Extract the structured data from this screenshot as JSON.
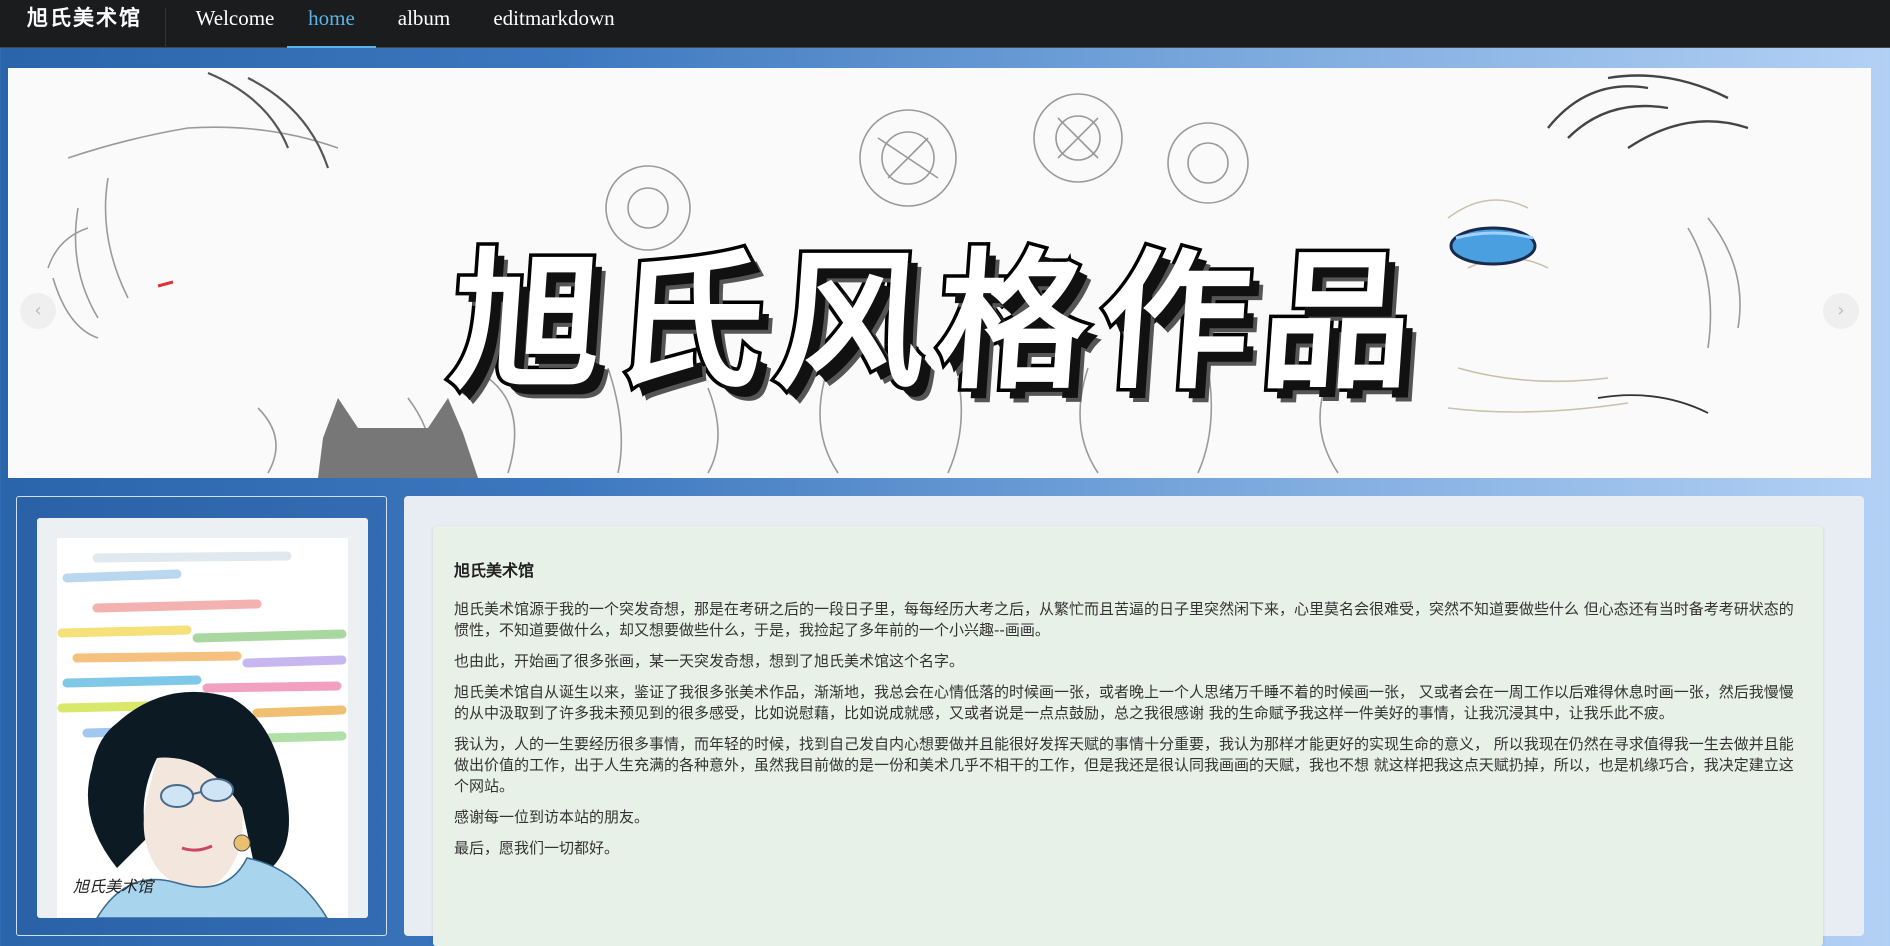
{
  "navbar": {
    "brand": "旭氏美术馆",
    "links": [
      {
        "label": "Welcome",
        "active": false
      },
      {
        "label": "home",
        "active": true
      },
      {
        "label": "album",
        "active": false
      },
      {
        "label": "editmarkdown",
        "active": false
      }
    ]
  },
  "banner": {
    "title": "旭氏风格作品",
    "prev_icon": "chevron-left-icon",
    "next_icon": "chevron-right-icon",
    "prev_glyph": "‹",
    "next_glyph": "›"
  },
  "profile": {
    "signature": "旭氏美术馆"
  },
  "article": {
    "title": "旭氏美术馆",
    "paragraphs": [
      "旭氏美术馆源于我的一个突发奇想，那是在考研之后的一段日子里，每每经历大考之后，从繁忙而且苦逼的日子里突然闲下来，心里莫名会很难受，突然不知道要做些什么 但心态还有当时备考考研状态的惯性，不知道要做什么，却又想要做些什么，于是，我捡起了多年前的一个小兴趣--画画。",
      "也由此，开始画了很多张画，某一天突发奇想，想到了旭氏美术馆这个名字。",
      "旭氏美术馆自从诞生以来，鉴证了我很多张美术作品，渐渐地，我总会在心情低落的时候画一张，或者晚上一个人思绪万千睡不着的时候画一张， 又或者会在一周工作以后难得休息时画一张，然后我慢慢的从中汲取到了许多我未预见到的很多感受，比如说慰藉，比如说成就感，又或者说是一点点鼓励，总之我很感谢 我的生命赋予我这样一件美好的事情，让我沉浸其中，让我乐此不疲。",
      "我认为，人的一生要经历很多事情，而年轻的时候，找到自己发自内心想要做并且能很好发挥天赋的事情十分重要，我认为那样才能更好的实现生命的意义， 所以我现在仍然在寻求值得我一生去做并且能做出价值的工作，出于人生充满的各种意外，虽然我目前做的是一份和美术几乎不相干的工作，但是我还是很认同我画画的天赋，我也不想 就这样把我这点天赋扔掉，所以，也是机缘巧合，我决定建立这个网站。",
      "感谢每一位到访本站的朋友。",
      "最后，愿我们一切都好。"
    ]
  },
  "colors": {
    "navbar_bg": "#1b1c1e",
    "nav_active": "#5ab4e6",
    "content_bg": "#e8f1e8"
  }
}
